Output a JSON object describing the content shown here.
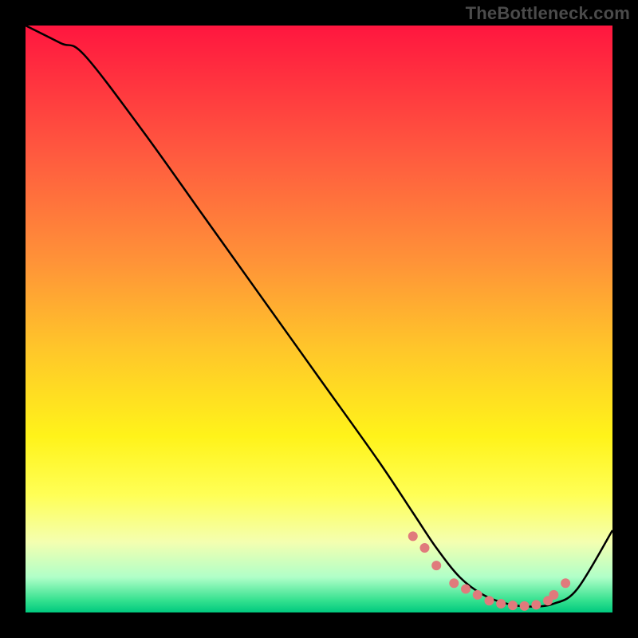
{
  "watermark": "TheBottleneck.com",
  "colors": {
    "frame": "#000000",
    "watermark": "#4b4b4b",
    "curve": "#000000",
    "dot": "#e07a7c",
    "gradient_stops": [
      "#ff163f",
      "#ff5a3f",
      "#ff9238",
      "#ffc62a",
      "#fff31a",
      "#ffff56",
      "#f4ffb0",
      "#b0ffc8",
      "#33e08e",
      "#00c97f"
    ]
  },
  "chart_data": {
    "type": "line",
    "title": "",
    "xlabel": "",
    "ylabel": "",
    "xlim": [
      0,
      100
    ],
    "ylim": [
      0,
      100
    ],
    "series": [
      {
        "name": "curve",
        "x": [
          0,
          6,
          10,
          20,
          30,
          40,
          50,
          60,
          66,
          70,
          74,
          78,
          82,
          86,
          90,
          94,
          100
        ],
        "values": [
          100,
          97,
          95,
          82,
          68,
          54,
          40,
          26,
          17,
          11,
          6,
          3,
          1.5,
          1,
          1.5,
          4,
          14
        ]
      }
    ],
    "markers": {
      "name": "dots",
      "x": [
        66,
        68,
        70,
        73,
        75,
        77,
        79,
        81,
        83,
        85,
        87,
        89,
        90,
        92
      ],
      "values": [
        13,
        11,
        8,
        5,
        4,
        3,
        2,
        1.5,
        1.2,
        1.1,
        1.3,
        2,
        3,
        5
      ]
    }
  }
}
